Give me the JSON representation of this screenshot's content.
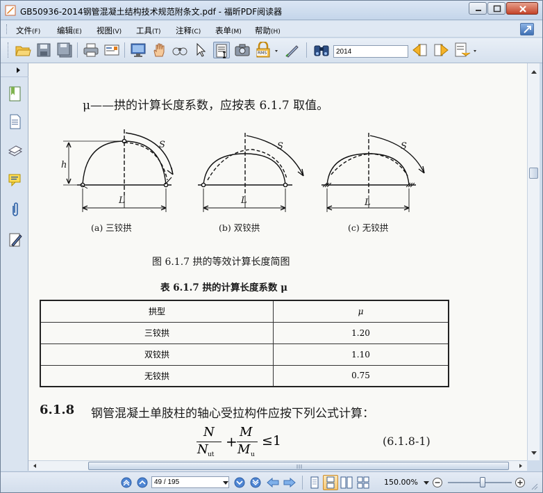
{
  "window": {
    "title": "GB50936-2014钢管混凝土结构技术规范附条文.pdf - 福昕PDF阅读器"
  },
  "menu": {
    "items": [
      {
        "label": "文件",
        "acc": "(F)"
      },
      {
        "label": "编辑",
        "acc": "(E)"
      },
      {
        "label": "视图",
        "acc": "(V)"
      },
      {
        "label": "工具",
        "acc": "(T)"
      },
      {
        "label": "注释",
        "acc": "(C)"
      },
      {
        "label": "表单",
        "acc": "(M)"
      },
      {
        "label": "帮助",
        "acc": "(H)"
      }
    ]
  },
  "toolbar": {
    "search_value": "2014",
    "stamp_label": "RMS"
  },
  "document": {
    "mu_line": "μ——拱的计算长度系数，应按表 6.1.7 取值。",
    "diagram": {
      "label_h": "h",
      "label_s": "S",
      "label_l": "L",
      "captions": [
        "(a) 三铰拱",
        "(b) 双铰拱",
        "(c) 无铰拱"
      ]
    },
    "figure_caption": "图 6.1.7   拱的等效计算长度简图",
    "table_title": "表 6.1.7   拱的计算长度系数 μ",
    "table": {
      "headers": [
        "拱型",
        "μ"
      ],
      "rows": [
        [
          "三铰拱",
          "1.20"
        ],
        [
          "双铰拱",
          "1.10"
        ],
        [
          "无铰拱",
          "0.75"
        ]
      ]
    },
    "section_number": "6.1.8",
    "section_text": "钢管混凝土单肢柱的轴心受拉构件应按下列公式计算：",
    "formula": {
      "n": "N",
      "n_sub_den": "N",
      "n_sub": "ut",
      "m": "M",
      "m_den": "M",
      "m_sub": "u",
      "rhs": "≤1",
      "number": "(6.1.8-1)"
    }
  },
  "status": {
    "page_value": "49 / 195",
    "zoom": "150.00%"
  },
  "colors": {
    "accent": "#3e6fb3",
    "window_bg": "#cfdcec"
  }
}
